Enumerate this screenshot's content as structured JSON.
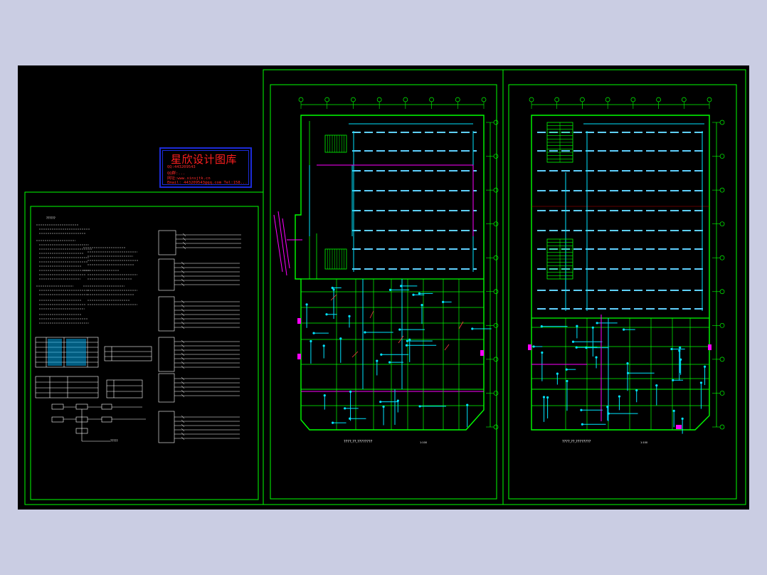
{
  "watermark": {
    "title": "星欣设计图库",
    "lines": [
      "QQ:443209543",
      "QQ群:...",
      "网址:www.xinsjtk.cn",
      "Email: 443209543@qq.com  Tel:158..."
    ]
  },
  "drawing": {
    "plan_left_caption": "????,??,????????",
    "plan_left_scale": "1:100",
    "plan_right_caption": "????,??,????????",
    "plan_right_scale": "1:100",
    "notes_caption": "?????",
    "notes_title": "??????"
  },
  "colors": {
    "background": "#cacde3",
    "sheet": "#000000",
    "frame": "#00ff00",
    "cyan": "#00e5ff",
    "light_blue": "#5fd0ff",
    "magenta": "#ff00ff",
    "white": "#ffffff",
    "stamp_border": "#1c2bd8",
    "stamp_text": "#ff1f1f"
  }
}
